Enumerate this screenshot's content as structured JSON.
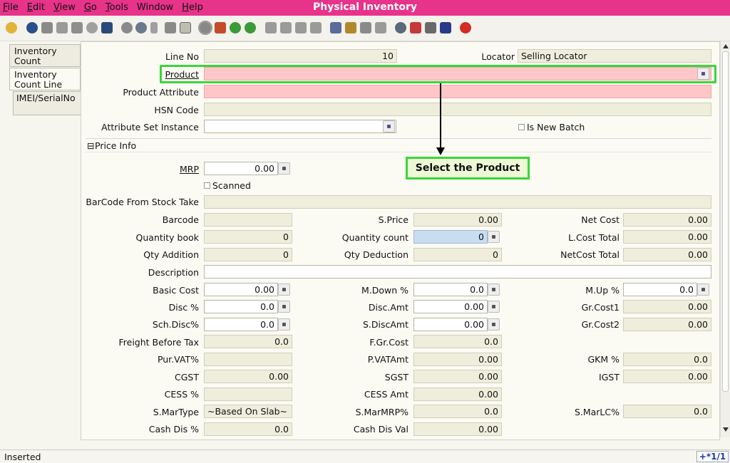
{
  "window": {
    "title": "Physical Inventory"
  },
  "menu": {
    "file": {
      "u": "F",
      "rest": "ile"
    },
    "edit": {
      "u": "E",
      "rest": "dit"
    },
    "view": {
      "u": "V",
      "rest": "iew"
    },
    "go": {
      "u": "G",
      "rest": "o"
    },
    "tools": {
      "u": "T",
      "rest": "ools"
    },
    "window": {
      "u": "",
      "rest": "Window"
    },
    "help": {
      "u": "H",
      "rest": "elp"
    }
  },
  "toolbar_icons": [
    "undo-icon",
    "help-icon",
    "new-icon",
    "copy-icon",
    "delete-icon",
    "close-x-icon",
    "save-icon",
    "refresh-icon",
    "find-icon",
    "attachment-icon",
    "chat-icon",
    "multi-view-icon",
    "history-icon",
    "home-icon",
    "back-icon",
    "forward-icon",
    "first-icon",
    "previous-icon",
    "next-icon",
    "last-icon",
    "report-icon",
    "archive-icon",
    "print-icon",
    "print-preview-icon",
    "zoom-across-icon",
    "workflow-icon",
    "process-icon",
    "product-info-icon",
    "exit-icon"
  ],
  "tabs": [
    {
      "label_1": "Inventory",
      "label_2": "Count"
    },
    {
      "label_1": "Inventory",
      "label_2": "Count Line"
    },
    {
      "label_1": "IMEI/SerialNo",
      "label_2": ""
    }
  ],
  "form": {
    "line_no": {
      "label": "Line No",
      "value": "10"
    },
    "locator": {
      "label": "Locator",
      "value": "Selling Locator"
    },
    "product": {
      "label": "Product",
      "value": ""
    },
    "product_attribute": {
      "label": "Product Attribute",
      "value": ""
    },
    "hsn_code": {
      "label": "HSN Code",
      "value": ""
    },
    "attribute_set_instance": {
      "label": "Attribute Set Instance",
      "value": ""
    },
    "is_new_batch": {
      "label": "Is New Batch"
    },
    "price_info": {
      "toggle": "⊟",
      "label": "Price Info"
    },
    "mrp": {
      "label": "MRP",
      "value": "0.00"
    },
    "scanned": {
      "label": "Scanned"
    },
    "barcode_from_stock_take": {
      "label": "BarCode From Stock Take",
      "value": ""
    },
    "barcode": {
      "label": "Barcode",
      "value": ""
    },
    "s_price": {
      "label": "S.Price",
      "value": "0.00"
    },
    "net_cost": {
      "label": "Net Cost",
      "value": "0.00"
    },
    "quantity_book": {
      "label": "Quantity book",
      "value": "0"
    },
    "quantity_count": {
      "label": "Quantity count",
      "value": "0"
    },
    "l_cost_total": {
      "label": "L.Cost Total",
      "value": "0.00"
    },
    "qty_addition": {
      "label": "Qty Addition",
      "value": "0"
    },
    "qty_deduction": {
      "label": "Qty Deduction",
      "value": "0"
    },
    "netcost_total": {
      "label": "NetCost Total",
      "value": "0.00"
    },
    "description": {
      "label": "Description",
      "value": ""
    },
    "basic_cost": {
      "label": "Basic Cost",
      "value": "0.00"
    },
    "m_down": {
      "label": "M.Down %",
      "value": "0.0"
    },
    "m_up": {
      "label": "M.Up %",
      "value": "0.0"
    },
    "disc_pct": {
      "label": "Disc %",
      "value": "0.0"
    },
    "disc_amt": {
      "label": "Disc.Amt",
      "value": "0.00"
    },
    "gr_cost1": {
      "label": "Gr.Cost1",
      "value": "0.00"
    },
    "sch_disc": {
      "label": "Sch.Disc%",
      "value": "0.0"
    },
    "s_discamt": {
      "label": "S.DiscAmt",
      "value": "0.00"
    },
    "gr_cost2": {
      "label": "Gr.Cost2",
      "value": "0.00"
    },
    "freight_before_tax": {
      "label": "Freight Before Tax",
      "value": "0.0"
    },
    "f_gr_cost": {
      "label": "F.Gr.Cost",
      "value": "0.0"
    },
    "pur_vat": {
      "label": "Pur.VAT%",
      "value": ""
    },
    "p_vatamt": {
      "label": "P.VATAmt",
      "value": "0.00"
    },
    "gkm": {
      "label": "GKM %",
      "value": "0.0"
    },
    "cgst": {
      "label": "CGST",
      "value": "0.00"
    },
    "sgst": {
      "label": "SGST",
      "value": "0.00"
    },
    "igst": {
      "label": "IGST",
      "value": "0.00"
    },
    "cess_pct": {
      "label": "CESS %",
      "value": ""
    },
    "cess_amt": {
      "label": "CESS Amt",
      "value": "0.00"
    },
    "s_martype": {
      "label": "S.MarType",
      "value": "~Based On Slab~"
    },
    "s_marmrp": {
      "label": "S.MarMRP%",
      "value": "0.0"
    },
    "s_marlc": {
      "label": "S.MarLC%",
      "value": "0.0"
    },
    "cash_dis_pct": {
      "label": "Cash Dis %",
      "value": "0.0"
    },
    "cash_dis_val": {
      "label": "Cash Dis Val",
      "value": "0.00"
    }
  },
  "annotation": {
    "callout": "Select the Product"
  },
  "status": {
    "text": "Inserted",
    "record": "+*1/1"
  },
  "colors": {
    "titlebar": "#e8338a",
    "highlight": "#3ad63a",
    "mandatory": "#ffc6c8",
    "focus": "#c9ddf1"
  }
}
